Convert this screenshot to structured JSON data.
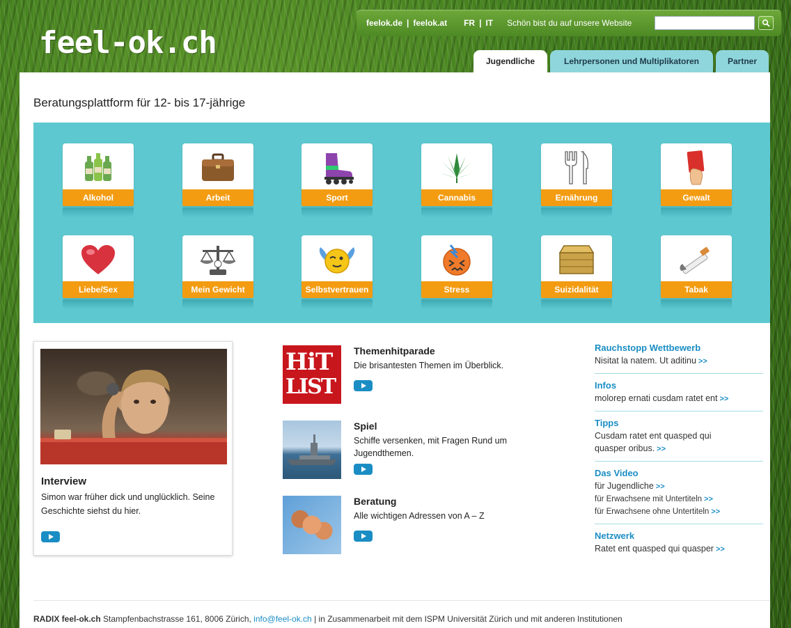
{
  "header": {
    "logo": "feel-ok.ch",
    "links": [
      "feelok.de",
      "feelok.at"
    ],
    "languages": [
      "FR",
      "IT"
    ],
    "tagline": "Schön bist du auf unsere Website",
    "search": {
      "value": "",
      "placeholder": ""
    },
    "tabs": [
      {
        "label": "Jugendliche",
        "active": true
      },
      {
        "label": "Lehrpersonen und Multiplikatoren",
        "active": false
      },
      {
        "label": "Partner",
        "active": false
      }
    ]
  },
  "page_title": "Beratungsplattform für 12- bis 17-jährige",
  "topics": [
    {
      "label": "Alkohol",
      "icon": "bottles-icon"
    },
    {
      "label": "Arbeit",
      "icon": "briefcase-icon"
    },
    {
      "label": "Sport",
      "icon": "inline-skate-icon"
    },
    {
      "label": "Cannabis",
      "icon": "cannabis-leaf-icon"
    },
    {
      "label": "Ernährung",
      "icon": "fork-knife-icon"
    },
    {
      "label": "Gewalt",
      "icon": "red-card-icon"
    },
    {
      "label": "Liebe/Sex",
      "icon": "heart-icon"
    },
    {
      "label": "Mein Gewicht",
      "icon": "scale-icon"
    },
    {
      "label": "Selbstvertrauen",
      "icon": "winged-smiley-icon"
    },
    {
      "label": "Stress",
      "icon": "stressed-face-icon"
    },
    {
      "label": "Suizidalität",
      "icon": "box-icon"
    },
    {
      "label": "Tabak",
      "icon": "cigarette-icon"
    }
  ],
  "interview": {
    "title": "Interview",
    "text": "Simon war früher dick und unglücklich. Seine Geschichte siehst du hier."
  },
  "features": [
    {
      "title": "Themenhitparade",
      "desc": "Die brisantesten Themen im Überblick.",
      "thumb_line1": "HiT",
      "thumb_line2": "LIST"
    },
    {
      "title": "Spiel",
      "desc": "Schiffe versenken, mit Fragen Rund um Jugendthemen."
    },
    {
      "title": "Beratung",
      "desc": "Alle wichtigen Adressen von A – Z"
    }
  ],
  "sidebar": [
    {
      "title": "Rauchstopp Wettbewerb",
      "lines": [
        "Nisitat la natem. Ut aditinu"
      ]
    },
    {
      "title": "Infos",
      "lines": [
        "molorep ernati cusdam ratet ent"
      ]
    },
    {
      "title": "Tipps",
      "lines": [
        "Cusdam ratet ent quasped qui",
        "quasper oribus."
      ]
    },
    {
      "title": "Das Video",
      "lines": [
        "für Jugendliche",
        "für Erwachsene mit Untertiteln",
        "für Erwachsene ohne Untertiteln"
      ]
    },
    {
      "title": "Netzwerk",
      "lines": [
        "Ratet ent quasped qui quasper"
      ]
    }
  ],
  "more_label": ">>",
  "footer": {
    "brand": "RADIX feel-ok.ch",
    "address": "Stampfenbachstrasse 161, 8006 Zürich,",
    "email": "info@feel-ok.ch",
    "rest": "| in Zusammenarbeit mit dem ISPM Universität Zürich und mit anderen Institutionen"
  },
  "colors": {
    "accent_blue": "#1a8dc4",
    "topic_bg": "#5ec8d0",
    "topic_label": "#f39c12",
    "top_bar": "#5a9a2c",
    "tab_inactive": "#8fd6dc"
  }
}
